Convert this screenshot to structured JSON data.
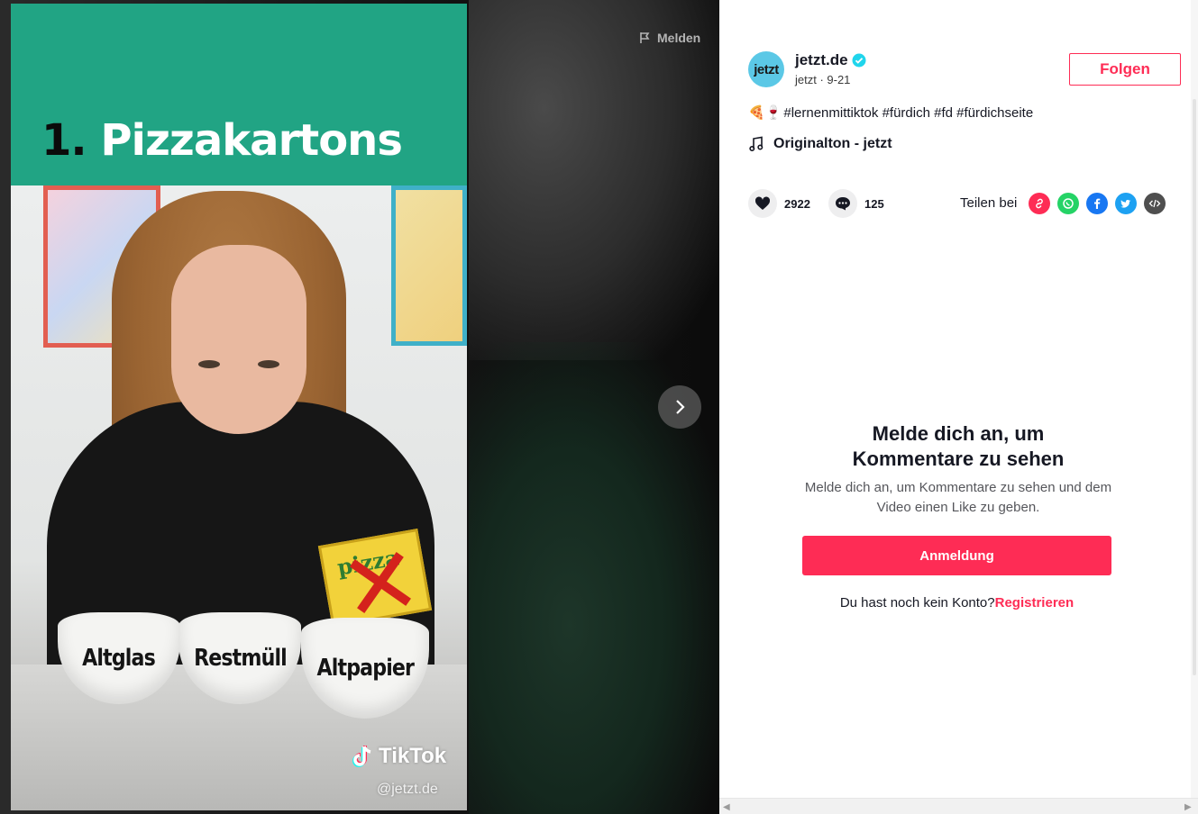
{
  "video": {
    "title_number": "1.",
    "title_text": "Pizzakartons",
    "pizza_box_text": "pizza",
    "bowls": [
      "Altglas",
      "Restmüll",
      "Altpapier"
    ],
    "watermark_brand": "TikTok",
    "watermark_handle": "@jetzt.de",
    "header_color": "#21a484"
  },
  "report": {
    "label": "Melden",
    "icon": "flag-icon"
  },
  "navigation": {
    "next_icon": "chevron-right-icon"
  },
  "author": {
    "avatar_text": "jetzt",
    "name": "jetzt.de",
    "verified_icon": "verified-badge-icon",
    "meta": "jetzt · 9-21",
    "follow_label": "Folgen"
  },
  "caption": {
    "emojis": "🍕🍷",
    "text": "#lernenmittiktok #fürdich #fd #fürdichseite"
  },
  "music": {
    "icon": "music-note-icon",
    "label": "Originalton - jetzt"
  },
  "stats": {
    "likes": "2922",
    "comments": "125",
    "like_icon": "heart-icon",
    "comment_icon": "comment-icon"
  },
  "share": {
    "label": "Teilen bei",
    "icons": [
      "link-icon",
      "whatsapp-icon",
      "facebook-icon",
      "twitter-icon",
      "embed-icon"
    ],
    "colors": [
      "#fe2c55",
      "#25d366",
      "#1877f2",
      "#1da1f2",
      "#4f4f4f"
    ]
  },
  "login": {
    "title": "Melde dich an, um Kommentare zu sehen",
    "subtitle": "Melde dich an, um Kommentare zu sehen und dem Video einen Like zu geben.",
    "button_label": "Anmeldung",
    "signup_prompt": "Du hast noch kein Konto?",
    "signup_link": "Registrieren"
  },
  "accent_color": "#fe2c55"
}
